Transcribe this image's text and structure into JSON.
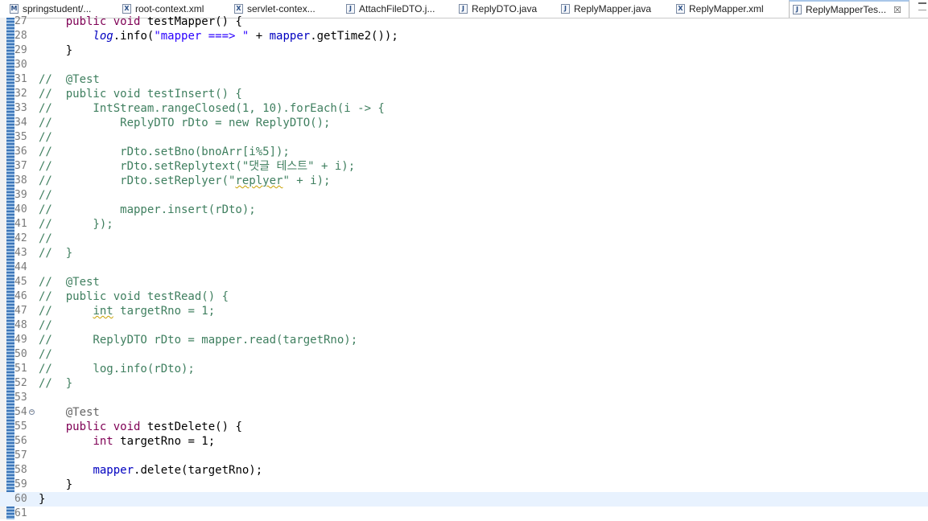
{
  "tabs": [
    {
      "label": "springstudent/...",
      "icon": "maven-icon",
      "glyph": "M",
      "active": false
    },
    {
      "label": "root-context.xml",
      "icon": "xml-file-icon",
      "glyph": "X",
      "active": false
    },
    {
      "label": "servlet-contex...",
      "icon": "xml-file-icon",
      "glyph": "X",
      "active": false
    },
    {
      "label": "AttachFileDTO.j...",
      "icon": "java-file-icon",
      "glyph": "J",
      "active": false
    },
    {
      "label": "ReplyDTO.java",
      "icon": "java-file-icon",
      "glyph": "J",
      "active": false
    },
    {
      "label": "ReplyMapper.java",
      "icon": "java-file-icon",
      "glyph": "J",
      "active": false
    },
    {
      "label": "ReplyMapper.xml",
      "icon": "xml-file-icon",
      "glyph": "X",
      "active": false
    },
    {
      "label": "ReplyMapperTes...",
      "icon": "java-file-icon",
      "glyph": "J",
      "active": true,
      "close": "☒"
    }
  ],
  "editor": {
    "current_line": 60,
    "lines": [
      {
        "n": "27",
        "segs": [
          [
            "",
            "    "
          ],
          [
            "kw",
            "public"
          ],
          [
            "",
            " "
          ],
          [
            "kw",
            "void"
          ],
          [
            "",
            " testMapper() {"
          ]
        ]
      },
      {
        "n": "28",
        "segs": [
          [
            "",
            "        "
          ],
          [
            "it",
            "log"
          ],
          [
            "",
            ".info("
          ],
          [
            "str",
            "\"mapper ===> \""
          ],
          [
            "",
            " + "
          ],
          [
            "fld",
            "mapper"
          ],
          [
            "",
            ".getTime2());"
          ]
        ]
      },
      {
        "n": "29",
        "segs": [
          [
            "",
            "    }"
          ]
        ]
      },
      {
        "n": "30",
        "segs": [
          [
            "",
            ""
          ]
        ]
      },
      {
        "n": "31",
        "segs": [
          [
            "cm",
            "//  @Test"
          ]
        ]
      },
      {
        "n": "32",
        "segs": [
          [
            "cm",
            "//  public void testInsert() {"
          ]
        ]
      },
      {
        "n": "33",
        "segs": [
          [
            "cm",
            "//      IntStream.rangeClosed(1, 10).forEach(i -> {"
          ]
        ]
      },
      {
        "n": "34",
        "segs": [
          [
            "cm",
            "//          ReplyDTO rDto = new ReplyDTO();"
          ]
        ]
      },
      {
        "n": "35",
        "segs": [
          [
            "cm",
            "//"
          ]
        ]
      },
      {
        "n": "36",
        "segs": [
          [
            "cm",
            "//          rDto.setBno(bnoArr[i%5]);"
          ]
        ]
      },
      {
        "n": "37",
        "segs": [
          [
            "cm",
            "//          rDto.setReplytext(\"댓글 테스트\" + i);"
          ]
        ]
      },
      {
        "n": "38",
        "segs": [
          [
            "cm",
            "//          rDto.setReplyer(\""
          ],
          [
            "cm sq",
            "replyer"
          ],
          [
            "cm",
            "\" + i);"
          ]
        ]
      },
      {
        "n": "39",
        "segs": [
          [
            "cm",
            "//"
          ]
        ]
      },
      {
        "n": "40",
        "segs": [
          [
            "cm",
            "//          mapper.insert(rDto);"
          ]
        ]
      },
      {
        "n": "41",
        "segs": [
          [
            "cm",
            "//      });"
          ]
        ]
      },
      {
        "n": "42",
        "segs": [
          [
            "cm",
            "//"
          ]
        ]
      },
      {
        "n": "43",
        "segs": [
          [
            "cm",
            "//  }"
          ]
        ]
      },
      {
        "n": "44",
        "segs": [
          [
            "",
            ""
          ]
        ]
      },
      {
        "n": "45",
        "segs": [
          [
            "cm",
            "//  @Test"
          ]
        ]
      },
      {
        "n": "46",
        "segs": [
          [
            "cm",
            "//  public void testRead() {"
          ]
        ]
      },
      {
        "n": "47",
        "segs": [
          [
            "cm",
            "//      "
          ],
          [
            "cm sq",
            "int"
          ],
          [
            "cm",
            " targetRno = 1;"
          ]
        ]
      },
      {
        "n": "48",
        "segs": [
          [
            "cm",
            "//"
          ]
        ]
      },
      {
        "n": "49",
        "segs": [
          [
            "cm",
            "//      ReplyDTO rDto = mapper.read(targetRno);"
          ]
        ]
      },
      {
        "n": "50",
        "segs": [
          [
            "cm",
            "//"
          ]
        ]
      },
      {
        "n": "51",
        "segs": [
          [
            "cm",
            "//      log.info(rDto);"
          ]
        ]
      },
      {
        "n": "52",
        "segs": [
          [
            "cm",
            "//  }"
          ]
        ]
      },
      {
        "n": "53",
        "segs": [
          [
            "",
            ""
          ]
        ]
      },
      {
        "n": "54",
        "fold": true,
        "segs": [
          [
            "",
            "    "
          ],
          [
            "an",
            "@Test"
          ]
        ]
      },
      {
        "n": "55",
        "segs": [
          [
            "",
            "    "
          ],
          [
            "kw",
            "public"
          ],
          [
            "",
            " "
          ],
          [
            "kw",
            "void"
          ],
          [
            "",
            " testDelete() {"
          ]
        ]
      },
      {
        "n": "56",
        "segs": [
          [
            "",
            "        "
          ],
          [
            "kw",
            "int"
          ],
          [
            "",
            " targetRno = 1;"
          ]
        ]
      },
      {
        "n": "57",
        "segs": [
          [
            "",
            ""
          ]
        ]
      },
      {
        "n": "58",
        "segs": [
          [
            "",
            "        "
          ],
          [
            "fld",
            "mapper"
          ],
          [
            "",
            ".delete(targetRno);"
          ]
        ]
      },
      {
        "n": "59",
        "segs": [
          [
            "",
            "    }"
          ]
        ]
      },
      {
        "n": "60",
        "segs": [
          [
            "",
            "}"
          ]
        ]
      },
      {
        "n": "61",
        "segs": [
          [
            "",
            ""
          ]
        ]
      }
    ]
  },
  "colors": {
    "keyword": "#7f0055",
    "comment": "#3f7f5f",
    "string": "#2a00ff",
    "field": "#0000c0",
    "annotation": "#646464",
    "current_line": "#e8f2fe"
  }
}
